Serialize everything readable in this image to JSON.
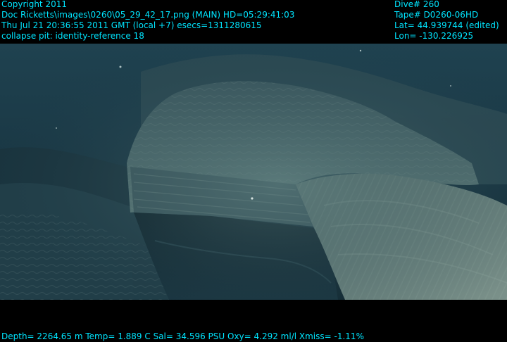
{
  "header_left": {
    "line1": "Copyright 2011",
    "line2": "Doc Ricketts\\images\\0260\\05_29_42_17.png (MAIN)  HD=05:29:41:03",
    "line3": "Thu Jul 21 20:36:55 2011 GMT (local +7)  esecs=1311280615",
    "line4": "collapse pit: identity-reference 18"
  },
  "header_right": {
    "dive": "Dive# 260",
    "tape": "Tape# D0260-06HD",
    "lat": "Lat= 44.939744 (edited)",
    "lon": "Lon= -130.226925"
  },
  "footer": {
    "sensors": "Depth= 2264.65 m  Temp= 1.889 C  Sal= 34.596 PSU  Oxy= 4.292 ml/l  Xmiss= -1.11%"
  },
  "colors": {
    "overlay_text": "#00e5ff",
    "background": "#000000",
    "water_deep": "#16323f",
    "rock_light": "#6e8a86"
  }
}
